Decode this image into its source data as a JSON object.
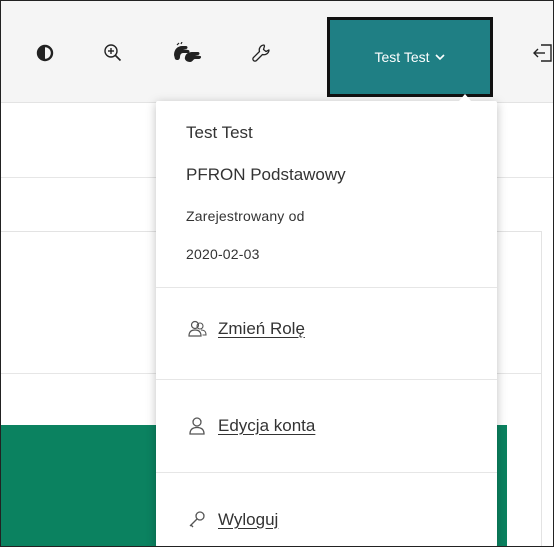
{
  "toolbar": {
    "icons": [
      "contrast-icon",
      "zoom-in-icon",
      "sign-language-icon",
      "settings-wrench-icon",
      "login-icon"
    ],
    "account_label": "Test Test",
    "accent_color": "#1f7f84"
  },
  "dropdown": {
    "user_name": "Test Test",
    "role": "PFRON Podstawowy",
    "registered_label": "Zarejestrowany od",
    "registered_date": "2020-02-03",
    "items": [
      {
        "label": "Zmień Rolę",
        "icon": "users-icon"
      },
      {
        "label": "Edycja konta",
        "icon": "user-icon"
      },
      {
        "label": "Wyloguj",
        "icon": "key-icon"
      }
    ]
  },
  "page": {
    "green_accent": "#0b8260"
  }
}
